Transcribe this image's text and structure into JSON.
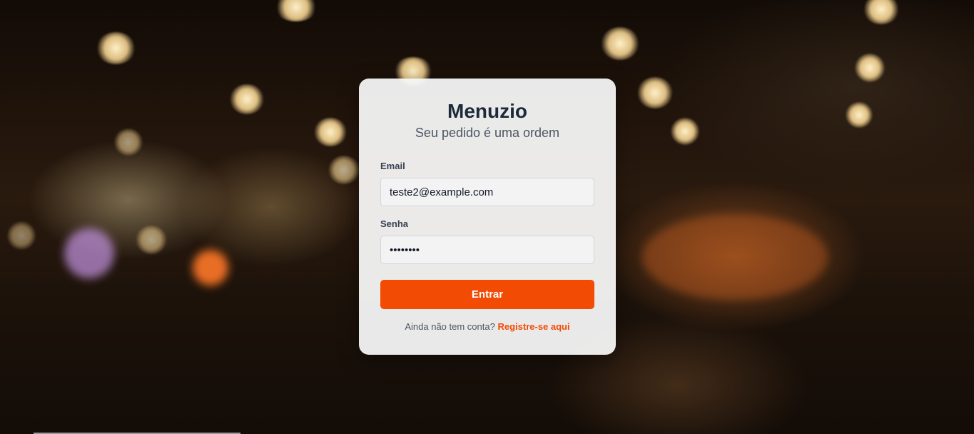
{
  "brand": {
    "title": "Menuzio",
    "tagline": "Seu pedido é uma ordem"
  },
  "form": {
    "email_label": "Email",
    "email_value": "teste2@example.com",
    "password_label": "Senha",
    "password_value": "password",
    "submit_label": "Entrar"
  },
  "footer": {
    "prompt": "Ainda não tem conta?",
    "register_link": "Registre-se aqui"
  },
  "colors": {
    "accent": "#f24b04",
    "title": "#1e2a3b",
    "card_background": "#f6f6f6"
  }
}
